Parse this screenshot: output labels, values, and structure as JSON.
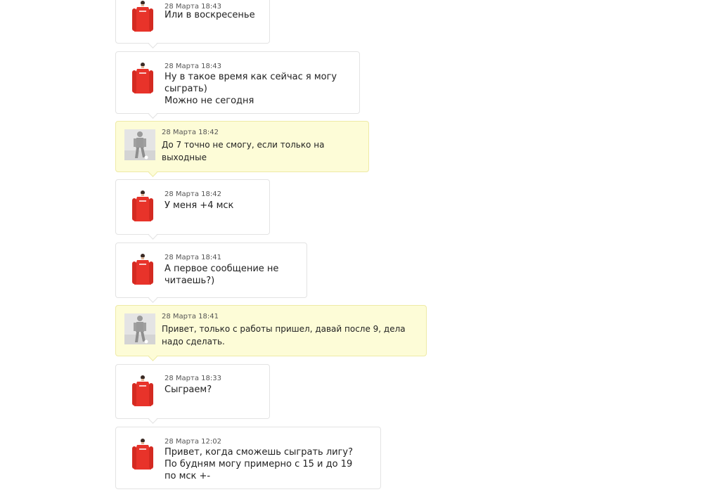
{
  "messages": [
    {
      "sender": "me",
      "time": "28 Марта 18:43",
      "text": "Или в воскресенье",
      "avatar_icon": "red-jacket-player-avatar"
    },
    {
      "sender": "me",
      "time": "28 Марта 18:43",
      "text": "Ну в такое время как сейчас я могу\nсыграть)\nМожно не сегодня",
      "avatar_icon": "red-jacket-player-avatar"
    },
    {
      "sender": "opponent",
      "time": "28 Марта 18:42",
      "text": "До 7 точно не смогу, если только на\nвыходные",
      "avatar_icon": "gray-silhouette-player-avatar"
    },
    {
      "sender": "me",
      "time": "28 Марта 18:42",
      "text": "У меня +4 мск",
      "avatar_icon": "red-jacket-player-avatar"
    },
    {
      "sender": "me",
      "time": "28 Марта 18:41",
      "text": "А первое сообщение не\nчитаешь?)",
      "avatar_icon": "red-jacket-player-avatar"
    },
    {
      "sender": "opponent",
      "time": "28 Марта 18:41",
      "text": "Привет, только с работы пришел, давай после 9, дела\nнадо сделать.",
      "avatar_icon": "gray-silhouette-player-avatar"
    },
    {
      "sender": "me",
      "time": "28 Марта 18:33",
      "text": "Сыграем?",
      "avatar_icon": "red-jacket-player-avatar"
    },
    {
      "sender": "me",
      "time": "28 Марта 12:02",
      "text": "Привет, когда сможешь сыграть лигу?\nПо будням могу примерно с 15 и до 19\nпо мск +-",
      "avatar_icon": "red-jacket-player-avatar"
    }
  ],
  "colors": {
    "mine_bubble_bg": "#ffffff",
    "theirs_bubble_bg": "#fdfcd7",
    "avatar_jacket": "#e8332a"
  }
}
